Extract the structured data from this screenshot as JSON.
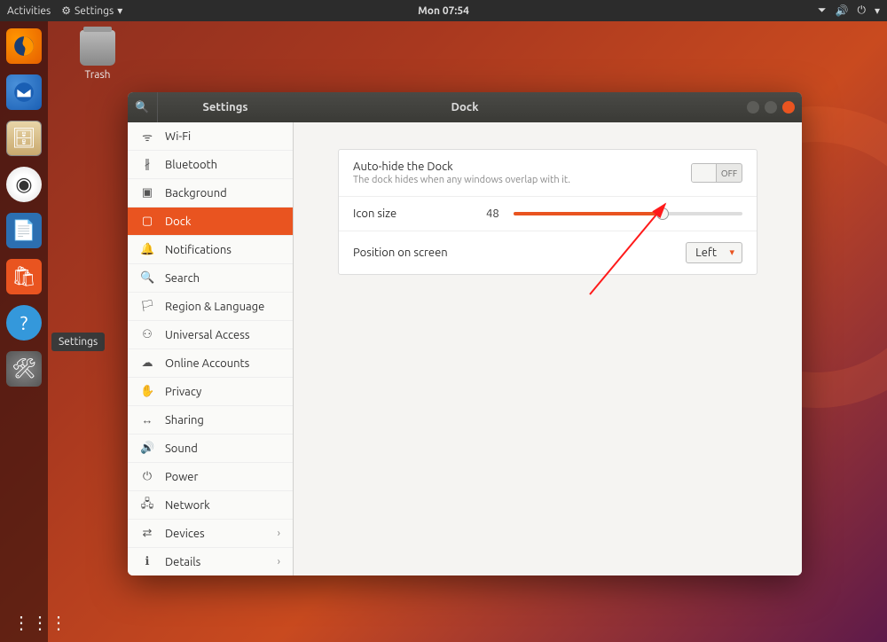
{
  "topbar": {
    "activities": "Activities",
    "app_menu": "Settings",
    "clock": "Mon 07:54"
  },
  "dock_tooltip": "Settings",
  "desktop": {
    "trash": "Trash"
  },
  "window": {
    "search_title": "Settings",
    "title": "Dock",
    "sidebar": [
      {
        "icon": "wifi",
        "label": "Wi-Fi"
      },
      {
        "icon": "bluetooth",
        "label": "Bluetooth"
      },
      {
        "icon": "background",
        "label": "Background"
      },
      {
        "icon": "dock",
        "label": "Dock",
        "active": true
      },
      {
        "icon": "notifications",
        "label": "Notifications"
      },
      {
        "icon": "search",
        "label": "Search"
      },
      {
        "icon": "region",
        "label": "Region & Language"
      },
      {
        "icon": "access",
        "label": "Universal Access"
      },
      {
        "icon": "accounts",
        "label": "Online Accounts"
      },
      {
        "icon": "privacy",
        "label": "Privacy"
      },
      {
        "icon": "sharing",
        "label": "Sharing"
      },
      {
        "icon": "sound",
        "label": "Sound"
      },
      {
        "icon": "power",
        "label": "Power"
      },
      {
        "icon": "network",
        "label": "Network"
      },
      {
        "icon": "devices",
        "label": "Devices",
        "chevron": true
      },
      {
        "icon": "details",
        "label": "Details",
        "chevron": true
      }
    ],
    "dock_settings": {
      "autohide_label": "Auto-hide the Dock",
      "autohide_desc": "The dock hides when any windows overlap with it.",
      "autohide_state": "OFF",
      "iconsize_label": "Icon size",
      "iconsize_value": "48",
      "position_label": "Position on screen",
      "position_value": "Left"
    }
  },
  "icons": {
    "wifi": "ᯤ",
    "bluetooth": "∦",
    "background": "▣",
    "dock": "▢",
    "notifications": "🔔",
    "search": "🔍",
    "region": "🏳",
    "access": "⚇",
    "accounts": "☁",
    "privacy": "✋",
    "sharing": "↔",
    "sound": "🔊",
    "power": "⏻",
    "network": "🖧",
    "devices": "⇄",
    "details": "ℹ"
  }
}
